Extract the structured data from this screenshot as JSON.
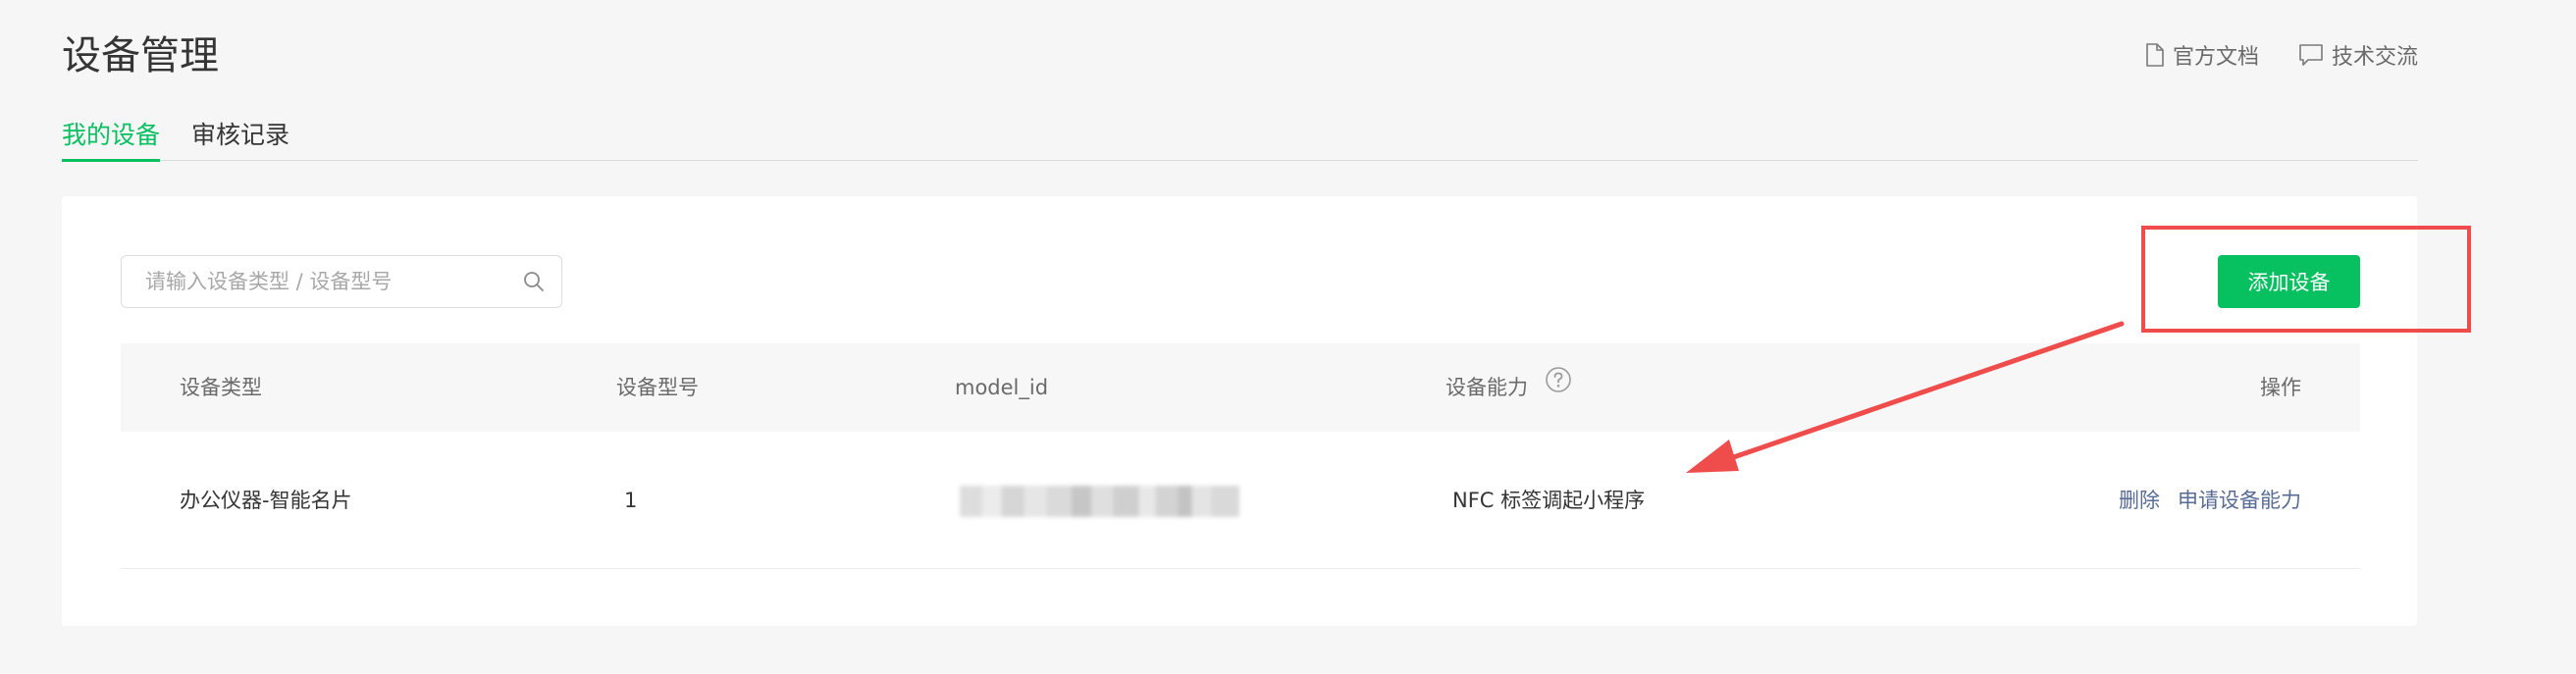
{
  "page": {
    "title": "设备管理",
    "links": [
      {
        "label": "官方文档",
        "icon": "document-icon"
      },
      {
        "label": "技术交流",
        "icon": "chat-bubble-icon"
      }
    ]
  },
  "tabs": [
    {
      "label": "我的设备",
      "active": true
    },
    {
      "label": "审核记录",
      "active": false
    }
  ],
  "search": {
    "placeholder": "请输入设备类型 / 设备型号",
    "value": ""
  },
  "toolbar": {
    "add_label": "添加设备"
  },
  "table": {
    "headers": {
      "type": "设备类型",
      "model": "设备型号",
      "model_id": "model_id",
      "capability": "设备能力",
      "actions": "操作"
    },
    "rows": [
      {
        "type": "办公仪器-智能名片",
        "model": "1",
        "model_id": "",
        "capability": "NFC 标签调起小程序",
        "actions": {
          "delete": "删除",
          "apply": "申请设备能力"
        }
      }
    ]
  },
  "colors": {
    "accent": "#07c160",
    "link": "#576b95",
    "annotation": "#ef4c4c",
    "background": "#f6f6f6"
  }
}
